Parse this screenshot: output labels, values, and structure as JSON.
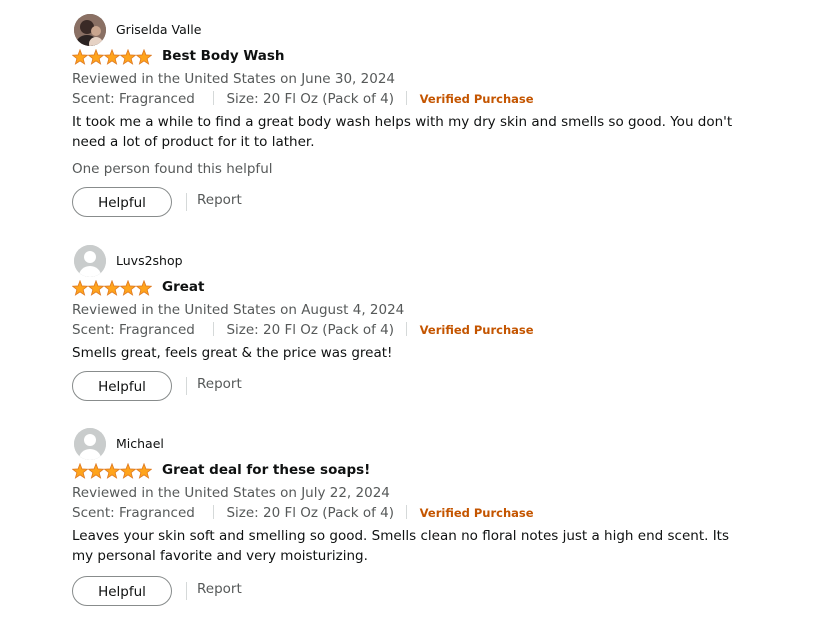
{
  "colors": {
    "star": "#ffa41c",
    "verified": "#c45500",
    "secondary_text": "#565959"
  },
  "reviews": [
    {
      "username": "Griselda Valle",
      "avatar": "user-photo",
      "rating": 5,
      "title": "Best Body Wash",
      "date": "Reviewed in the United States on June 30, 2024",
      "scent": "Scent: Fragranced",
      "size": "Size: 20 Fl Oz (Pack of 4)",
      "verified": "Verified Purchase",
      "body": "It took me a while to find a great body wash helps with my dry skin and smells so good. You don't need a lot of product for it to lather.",
      "helpful_count": "One person found this helpful",
      "helpful_label": "Helpful",
      "report_label": "Report"
    },
    {
      "username": "Luvs2shop",
      "avatar": "default-avatar",
      "rating": 5,
      "title": "Great",
      "date": "Reviewed in the United States on August 4, 2024",
      "scent": "Scent: Fragranced",
      "size": "Size: 20 Fl Oz (Pack of 4)",
      "verified": "Verified Purchase",
      "body": "Smells great, feels great & the price was great!",
      "helpful_label": "Helpful",
      "report_label": "Report"
    },
    {
      "username": "Michael",
      "avatar": "default-avatar",
      "rating": 5,
      "title": "Great deal for these soaps!",
      "date": "Reviewed in the United States on July 22, 2024",
      "scent": "Scent: Fragranced",
      "size": "Size: 20 Fl Oz (Pack of 4)",
      "verified": "Verified Purchase",
      "body": "Leaves your skin soft and smelling so good. Smells clean no floral notes just a high end scent. Its my personal favorite and very moisturizing.",
      "helpful_label": "Helpful",
      "report_label": "Report"
    }
  ]
}
